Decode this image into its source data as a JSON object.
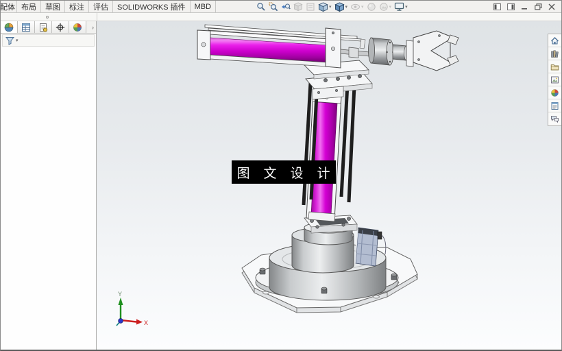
{
  "command_manager": {
    "tabs": [
      {
        "label": "配体"
      },
      {
        "label": "布局"
      },
      {
        "label": "草图"
      },
      {
        "label": "标注"
      },
      {
        "label": "评估"
      },
      {
        "label": "SOLIDWORKS 插件"
      },
      {
        "label": "MBD"
      }
    ]
  },
  "headsup_toolbar": {
    "tools": [
      {
        "name": "zoom-to-fit",
        "enabled": true,
        "dropdown": false
      },
      {
        "name": "zoom-to-area",
        "enabled": true,
        "dropdown": false
      },
      {
        "name": "previous-view",
        "enabled": true,
        "dropdown": false
      },
      {
        "name": "section-view",
        "enabled": false,
        "dropdown": false
      },
      {
        "name": "dynamic-annotation-views",
        "enabled": false,
        "dropdown": false
      },
      {
        "name": "view-orientation",
        "enabled": true,
        "dropdown": true
      },
      {
        "name": "display-style",
        "enabled": true,
        "dropdown": true
      },
      {
        "name": "hide-show-items",
        "enabled": false,
        "dropdown": true
      },
      {
        "name": "edit-appearance",
        "enabled": false,
        "dropdown": false
      },
      {
        "name": "apply-scene",
        "enabled": false,
        "dropdown": true
      },
      {
        "name": "view-settings",
        "enabled": true,
        "dropdown": true
      }
    ]
  },
  "window_controls": [
    "pane-toggle-left",
    "pane-toggle-right",
    "minimize",
    "restore",
    "close"
  ],
  "left_panel": {
    "tabs": [
      "feature-manager",
      "property-manager",
      "configuration-manager",
      "dimxpert-manager",
      "display-manager"
    ],
    "expand_chevron": "›",
    "filter_icon": "filter-funnel",
    "filter_caret": "▾"
  },
  "task_pane": {
    "items": [
      "solidworks-resources",
      "design-library",
      "file-explorer",
      "view-palette",
      "appearances-scenes",
      "custom-properties",
      "solidworks-forum"
    ]
  },
  "viewport": {
    "watermark_text": "图 文 设 计",
    "triad": {
      "x_label": "X",
      "y_label": "Y"
    },
    "colors": {
      "cylinder_magenta": "#d400d4",
      "guide_rod_black": "#1e1e1e",
      "metal_gray": "#c4c7c9",
      "valve_blue": "#b3bdd1",
      "viewport_top": "#dfe3e6",
      "viewport_bottom": "#fcfdfe",
      "triad_x_red": "#cc1f1f",
      "triad_y_green": "#1e8f1e",
      "triad_origin_blue": "#2a35c8"
    }
  }
}
